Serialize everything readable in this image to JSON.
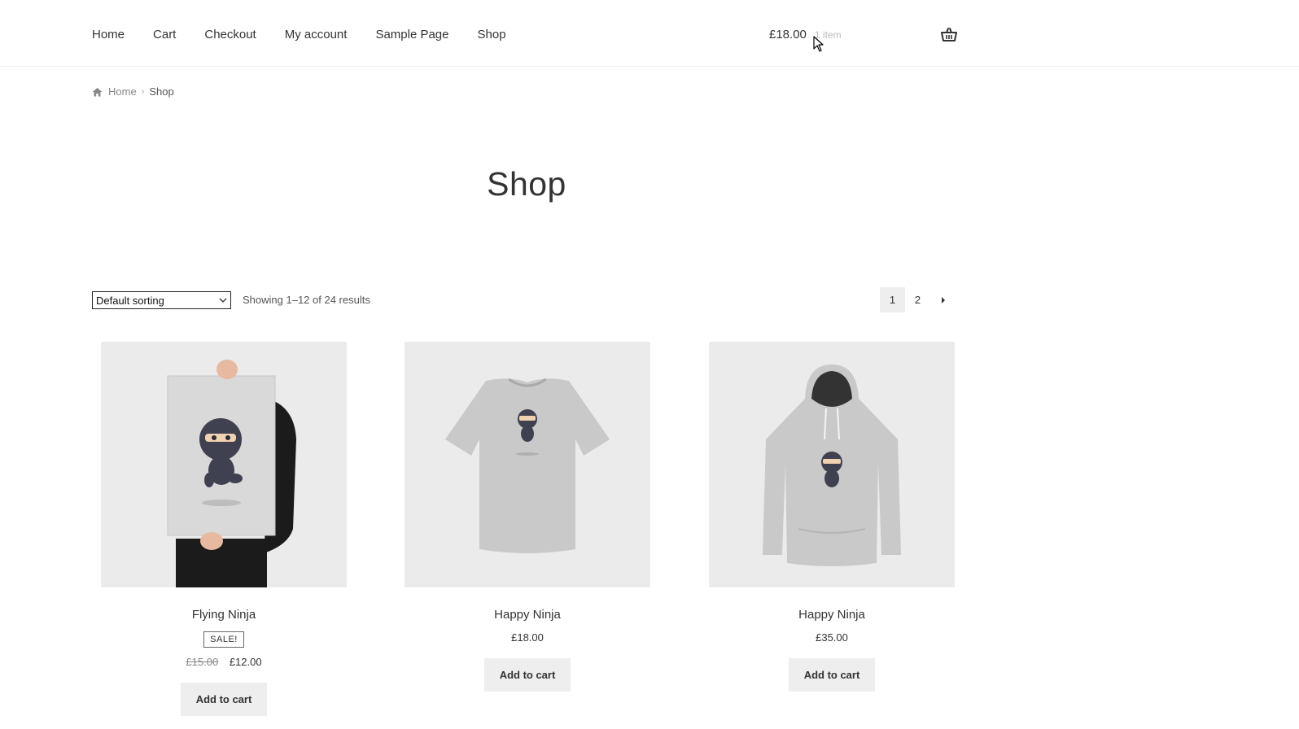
{
  "nav": {
    "items": [
      "Home",
      "Cart",
      "Checkout",
      "My account",
      "Sample Page",
      "Shop"
    ]
  },
  "mini_cart": {
    "amount": "£18.00",
    "count": "1 item"
  },
  "breadcrumb": {
    "home": "Home",
    "current": "Shop"
  },
  "page": {
    "title": "Shop"
  },
  "toolbar": {
    "sort_selected": "Default sorting",
    "result_count": "Showing 1–12 of 24 results",
    "pages": [
      "1",
      "2"
    ],
    "current_page": "1"
  },
  "products": [
    {
      "title": "Flying Ninja",
      "badge": "SALE!",
      "old_price": "£15.00",
      "price": "£12.00",
      "button": "Add to cart"
    },
    {
      "title": "Happy Ninja",
      "price": "£18.00",
      "button": "Add to cart"
    },
    {
      "title": "Happy Ninja",
      "price": "£35.00",
      "button": "Add to cart"
    }
  ],
  "colors": {
    "accent": "#333333",
    "button_bg": "#eeeeee",
    "muted": "#888888"
  }
}
